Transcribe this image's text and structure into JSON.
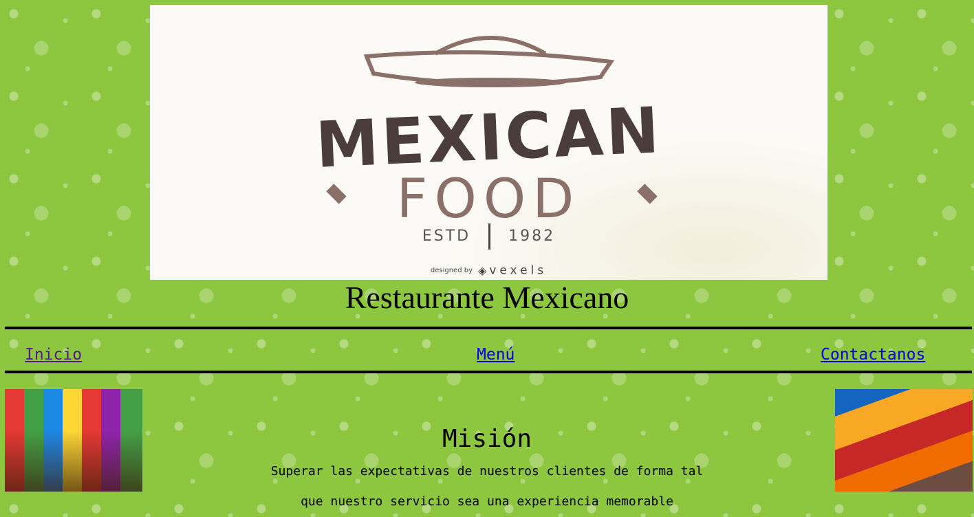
{
  "banner": {
    "logo_line1": "MEXICAN",
    "logo_line2": "FOOD",
    "estd_label": "ESTD",
    "estd_year": "1982",
    "credit_small": "designed by",
    "credit_brand": "vexels"
  },
  "page": {
    "title": "Restaurante Mexicano"
  },
  "nav": {
    "items": [
      {
        "label": "Inicio",
        "color": "#551a8b"
      },
      {
        "label": "Menú",
        "color": "#0000ee"
      },
      {
        "label": "Contactanos",
        "color": "#0000ee"
      }
    ]
  },
  "mision": {
    "title": "Misión",
    "text_line1": "Superar las expectativas de nuestros clientes de forma tal",
    "text_line2": "que nuestro servicio sea una experiencia memorable"
  },
  "colors": {
    "background": "#8dc63f",
    "logo_dark": "#4a3d3b",
    "logo_muted": "#8a7068"
  }
}
